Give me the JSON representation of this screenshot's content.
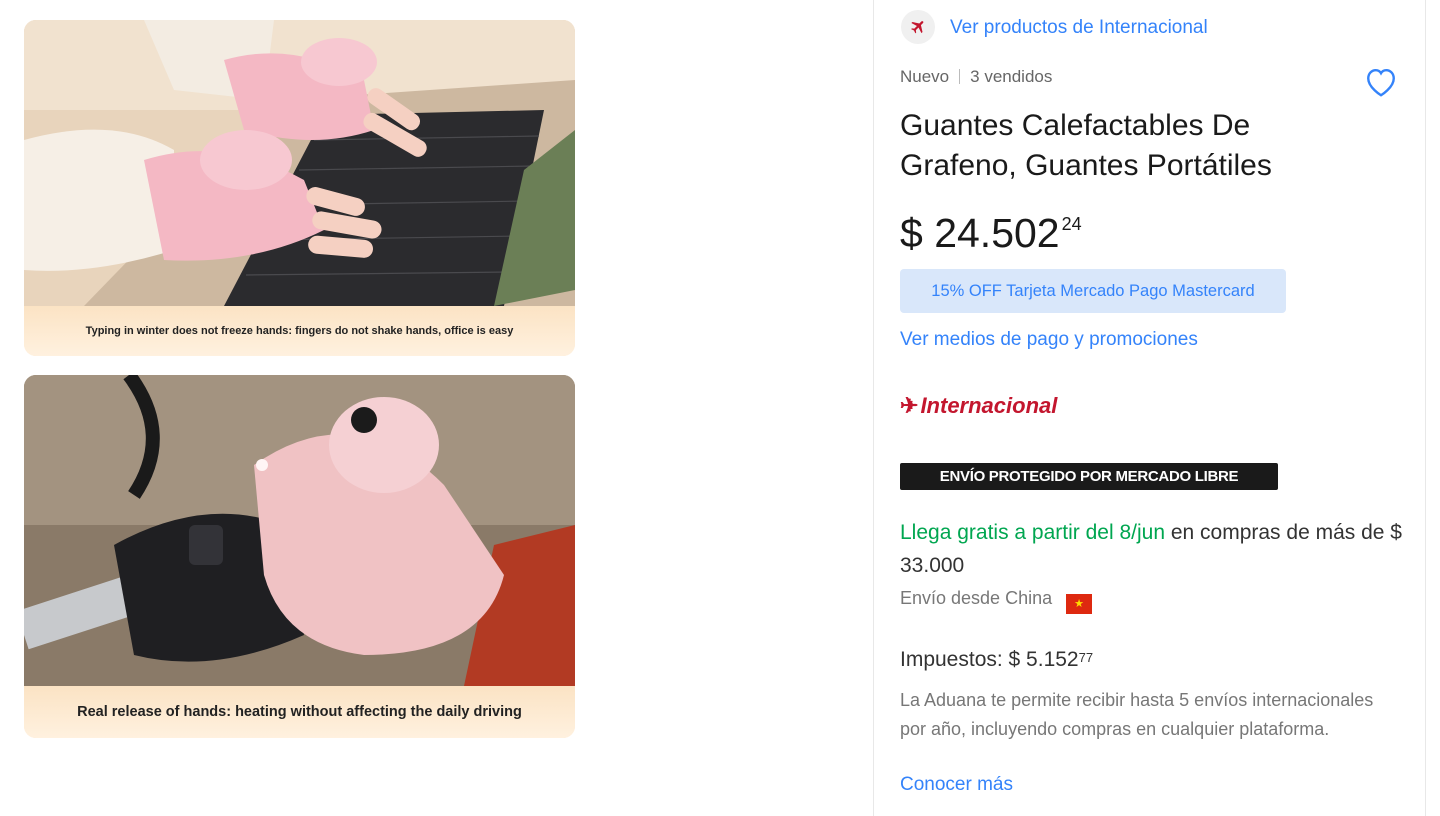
{
  "gallery": {
    "images": [
      {
        "alt": "Pink heated gloves typing on laptop",
        "caption": "Typing in winter does not freeze hands: fingers do not shake hands, office is easy"
      },
      {
        "alt": "Pink heated glove on motorcycle handlebar",
        "caption": "Real release of hands: heating without affecting the daily driving"
      }
    ]
  },
  "product": {
    "store_link": "Ver productos de Internacional",
    "condition": "Nuevo",
    "sold": "3 vendidos",
    "title": "Guantes Calefactables De Grafeno, Guantes Portátiles",
    "price": {
      "main": "$ 24.502",
      "cents": "24"
    },
    "promo_label": "15% OFF Tarjeta Mercado Pago Mastercard",
    "payment_link": "Ver medios de pago y promociones",
    "international_label": "Internacional",
    "protected_badge": "ENVÍO PROTEGIDO POR MERCADO LIBRE",
    "shipping": {
      "highlight": "Llega gratis a partir del 8/jun",
      "rest": " en compras de más de $ 33.000",
      "origin": "Envío desde China"
    },
    "taxes": {
      "label": "Impuestos: $ 5.152",
      "cents": "77"
    },
    "customs_note": "La Aduana te permite recibir hasta 5 envíos internacionales por año, incluyendo compras en cualquier plataforma.",
    "learn_more": "Conocer más"
  },
  "colors": {
    "link": "#3483fa",
    "green": "#00a650",
    "international_red": "#c3162e",
    "promo_bg": "#d9e7fa"
  },
  "icons": [
    "plane-icon",
    "heart-icon",
    "china-flag-icon"
  ]
}
